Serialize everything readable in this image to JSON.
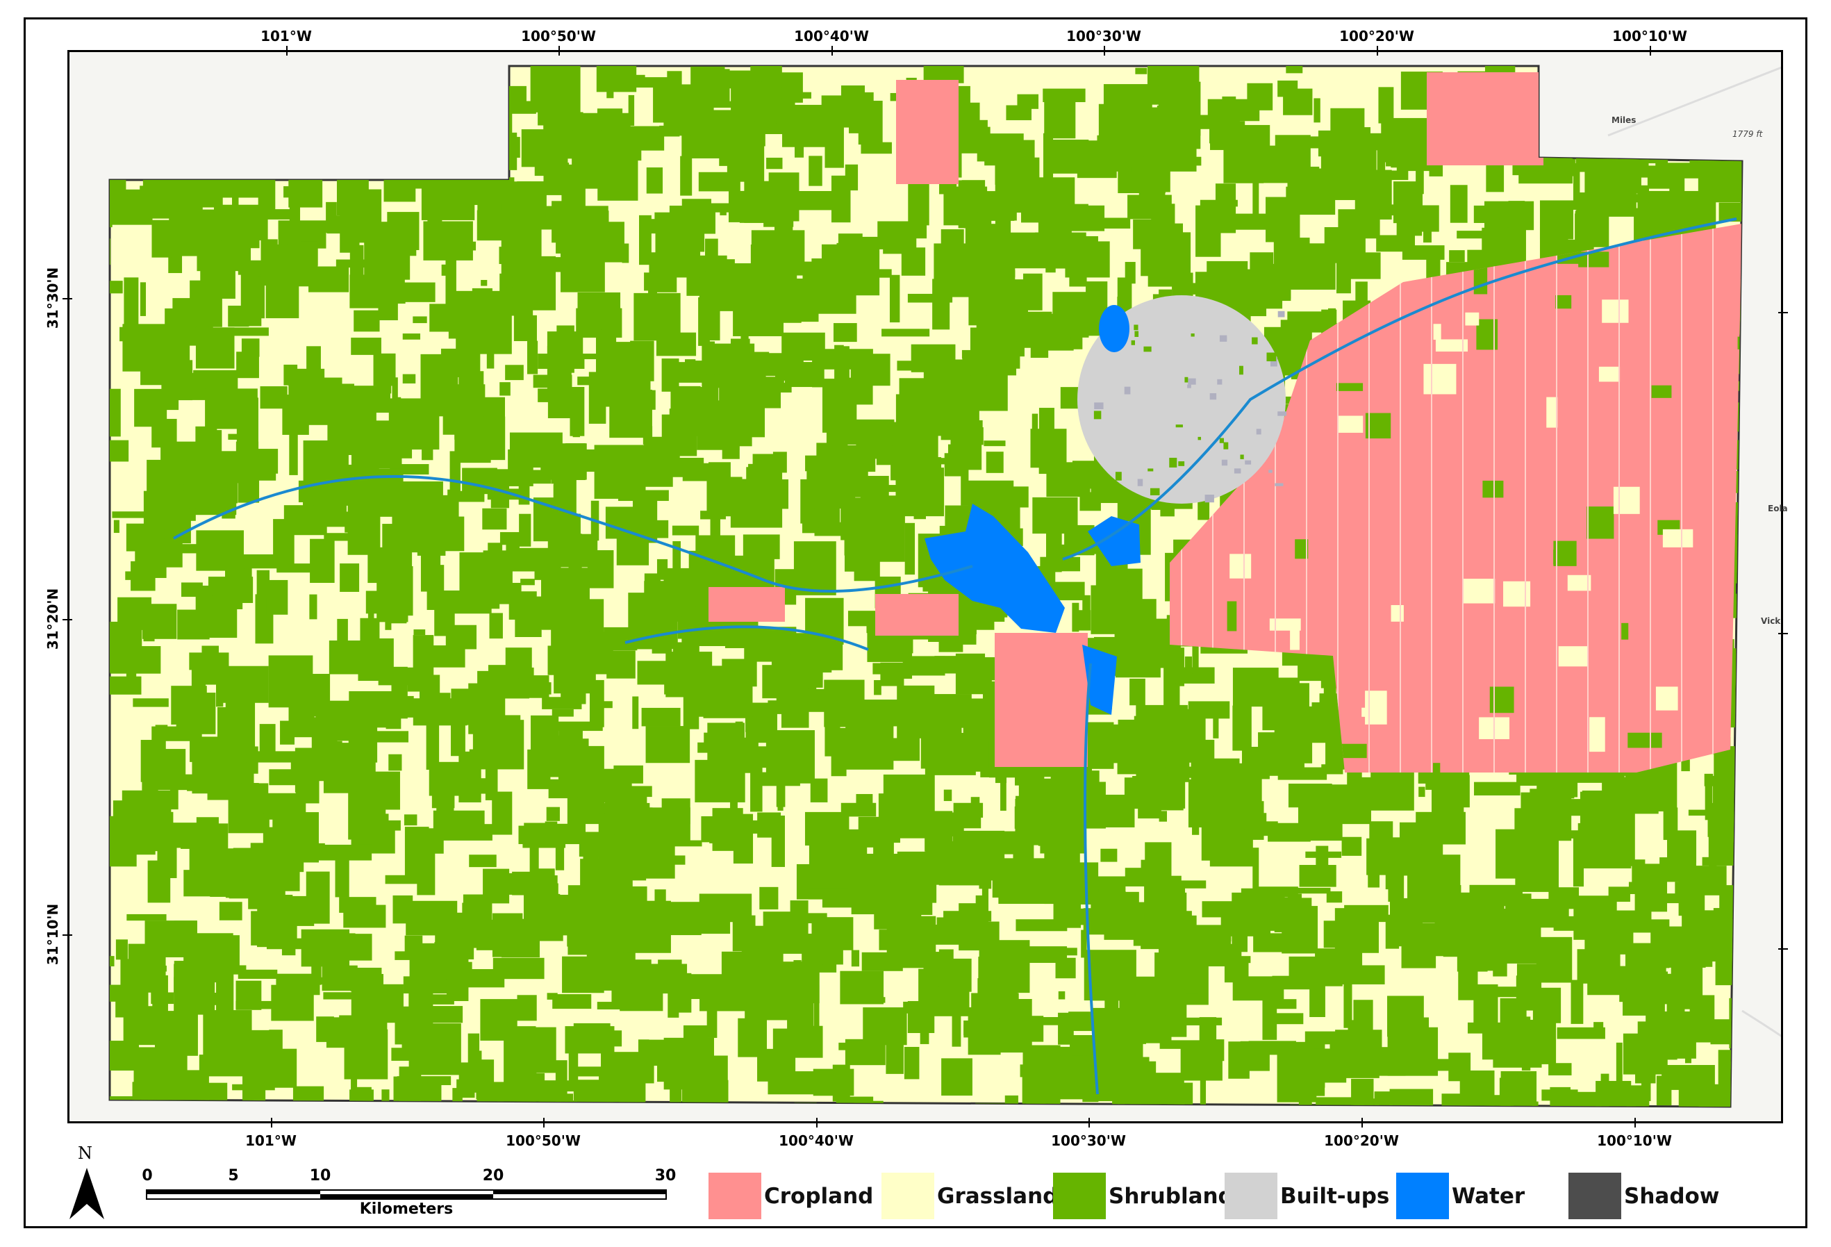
{
  "map": {
    "longitude_labels": [
      "101°W",
      "100°50'W",
      "100°40'W",
      "100°30'W",
      "100°20'W",
      "100°10'W"
    ],
    "latitude_labels": [
      "31°30'N",
      "31°20'N",
      "31°10'N"
    ],
    "basemap_labels": [
      "Miles",
      "1779 ft",
      "Eola",
      "Vick"
    ]
  },
  "north_arrow": {
    "label": "N"
  },
  "scale_bar": {
    "ticks": [
      "0",
      "5",
      "10",
      "20",
      "30"
    ],
    "unit": "Kilometers"
  },
  "legend": [
    {
      "label": "Cropland",
      "color": "#ff9090"
    },
    {
      "label": "Grassland",
      "color": "#ffffc8"
    },
    {
      "label": "Shrubland",
      "color": "#66b400"
    },
    {
      "label": "Built-ups",
      "color": "#d2d2d2"
    },
    {
      "label": "Water",
      "color": "#0080ff"
    },
    {
      "label": "Shadow",
      "color": "#4d4d4d"
    }
  ]
}
